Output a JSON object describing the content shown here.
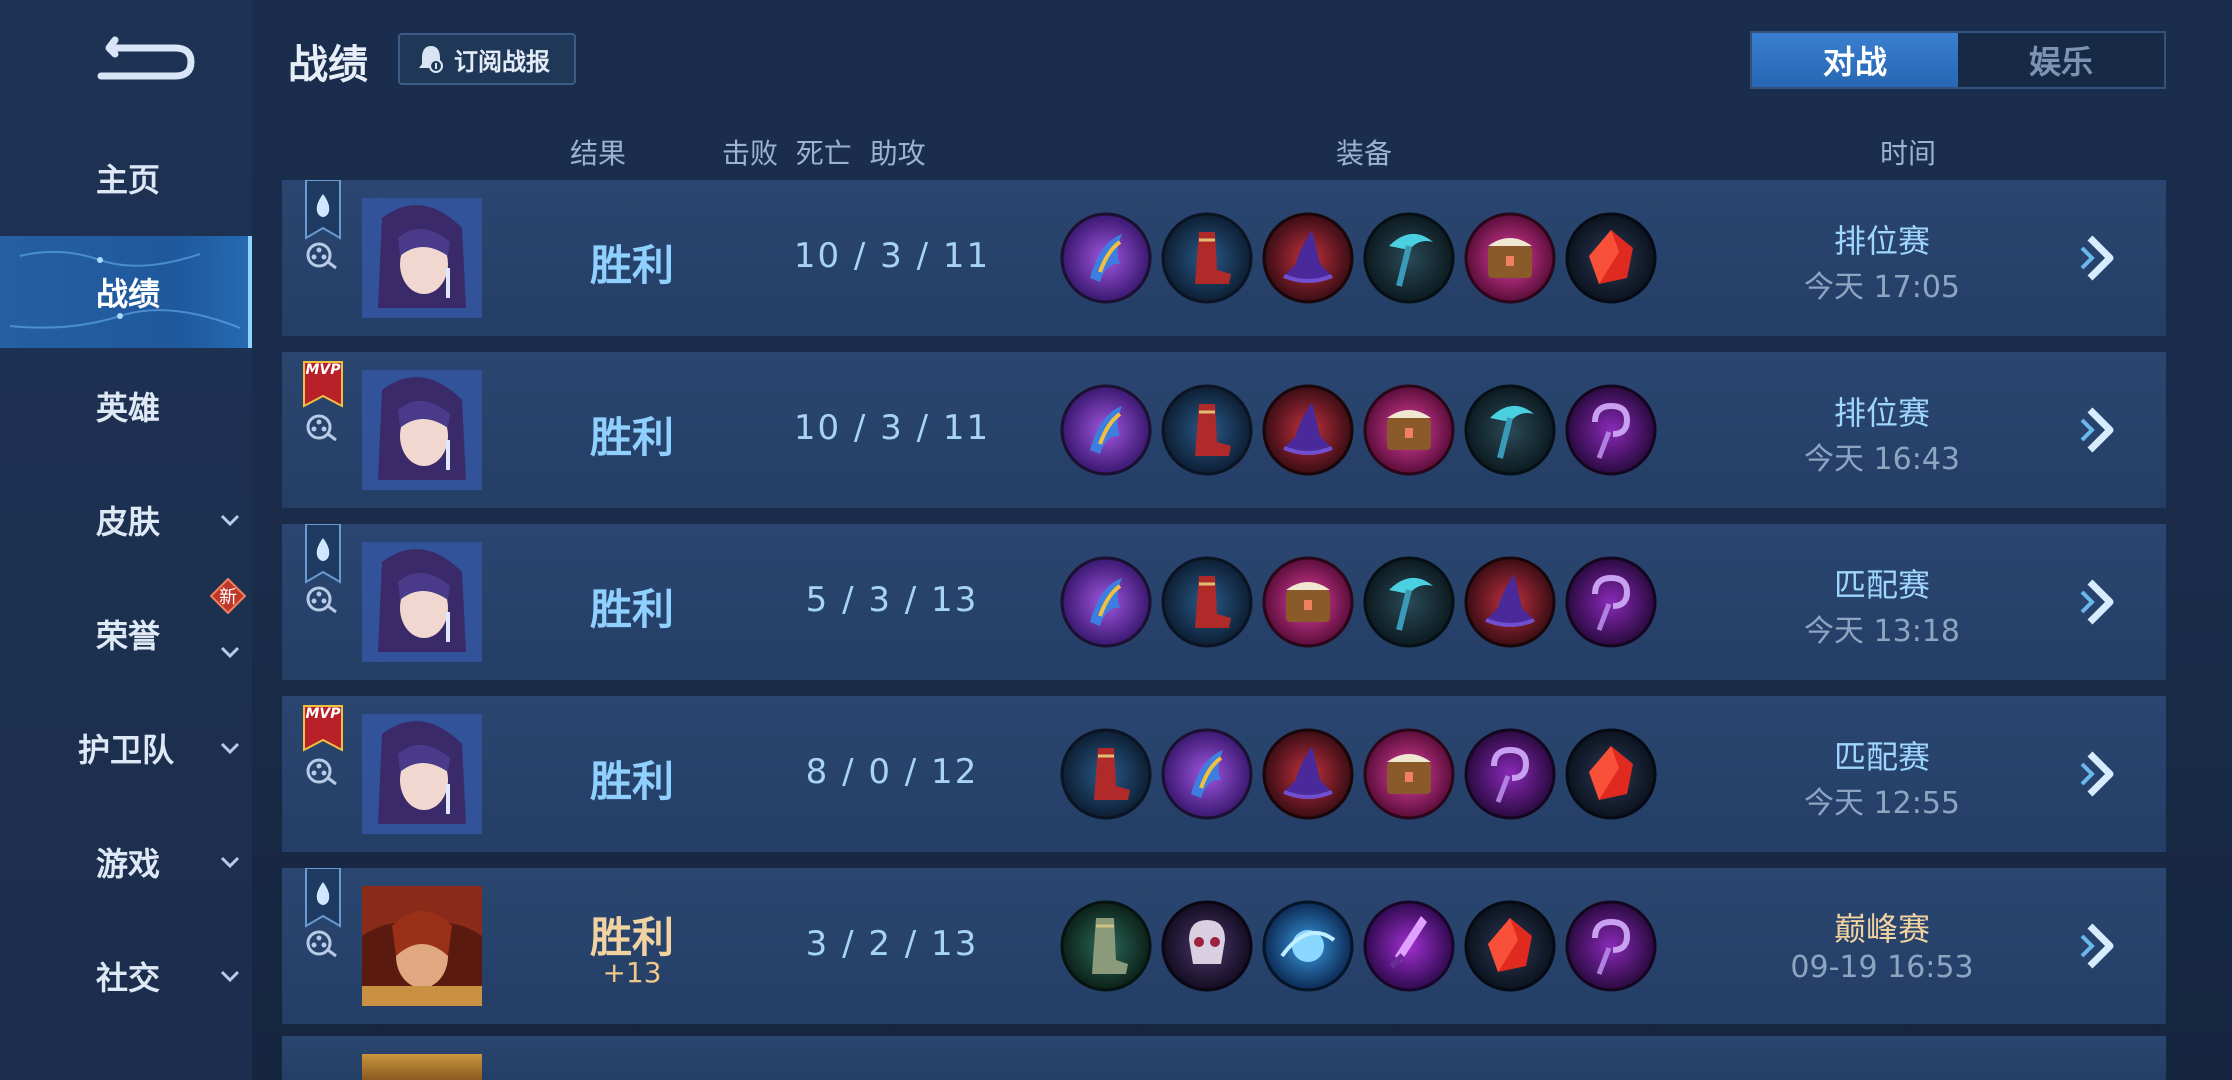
{
  "header": {
    "title": "战绩",
    "subscribe_label": "订阅战报"
  },
  "tabs": [
    {
      "label": "对战",
      "active": true
    },
    {
      "label": "娱乐",
      "active": false
    }
  ],
  "sidebar": {
    "items": [
      {
        "label": "主页"
      },
      {
        "label": "战绩",
        "active": true
      },
      {
        "label": "英雄"
      },
      {
        "label": "皮肤",
        "expandable": true
      },
      {
        "label": "荣誉",
        "expandable": true,
        "badge": "新"
      },
      {
        "label": "护卫队",
        "expandable": true
      },
      {
        "label": "游戏",
        "expandable": true
      },
      {
        "label": "社交",
        "expandable": true
      }
    ]
  },
  "columns": {
    "result": "结果",
    "kda": "击败  死亡  助攻",
    "equipment": "装备",
    "time": "时间"
  },
  "matches": [
    {
      "result": "胜利",
      "kda": "10 / 3 / 11",
      "mode": "排位赛",
      "time": "今天 17:05",
      "badge": "rank-flag",
      "hero": "blue-hero",
      "items": [
        "purple-feather",
        "red-boots",
        "purple-hat",
        "teal-scythe",
        "pink-book",
        "red-gem"
      ]
    },
    {
      "result": "胜利",
      "kda": "10 / 3 / 11",
      "mode": "排位赛",
      "time": "今天 16:43",
      "badge": "MVP",
      "hero": "blue-hero",
      "items": [
        "purple-feather",
        "red-boots",
        "purple-hat",
        "pink-book",
        "teal-scythe",
        "purple-staff"
      ]
    },
    {
      "result": "胜利",
      "kda": "5 / 3 / 13",
      "mode": "匹配赛",
      "time": "今天 13:18",
      "badge": "rank-flag",
      "hero": "blue-hero",
      "items": [
        "purple-feather",
        "red-boots",
        "pink-book",
        "teal-scythe",
        "purple-hat",
        "purple-staff"
      ]
    },
    {
      "result": "胜利",
      "kda": "8 / 0 / 12",
      "mode": "匹配赛",
      "time": "今天 12:55",
      "badge": "MVP",
      "hero": "blue-hero",
      "items": [
        "red-boots",
        "purple-feather",
        "purple-hat",
        "pink-book",
        "purple-staff",
        "red-gem"
      ]
    },
    {
      "result": "胜利",
      "bonus": "+13",
      "kda": "3 / 2 / 13",
      "mode": "巅峰赛",
      "time": "09-19  16:53",
      "badge": "rank-flag",
      "hero": "red-hero",
      "gold": true,
      "items": [
        "green-boots",
        "skull-mask",
        "blue-orb",
        "purple-blade",
        "red-gem",
        "purple-staff"
      ]
    }
  ],
  "colors": {
    "accent": "#3a7fd0",
    "win": "#8fd0ff",
    "peak": "#f0d3a0"
  }
}
